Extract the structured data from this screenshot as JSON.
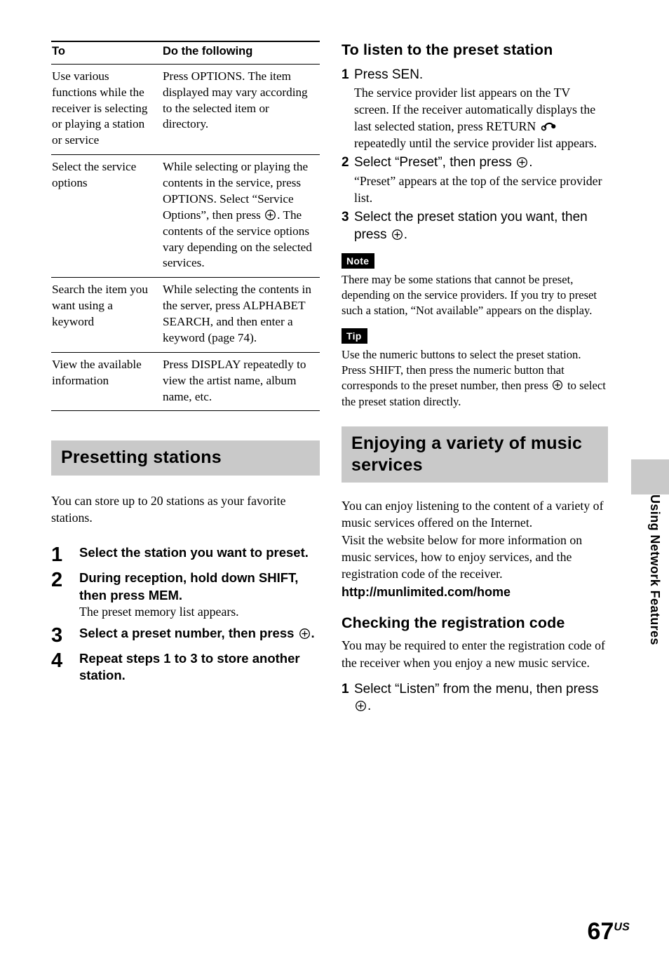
{
  "page": {
    "number": "67",
    "region_suffix": "US",
    "thumb_tab_label": "Using Network Features"
  },
  "left_column": {
    "table": {
      "headers": [
        "To",
        "Do the following"
      ],
      "rows": [
        {
          "to": "Use various functions while the receiver is selecting or playing a station or service",
          "do_parts": [
            "Press OPTIONS. The item displayed may vary according to the selected item or directory."
          ]
        },
        {
          "to": "Select the service options",
          "do_parts": [
            "While selecting or playing the contents in the service, press OPTIONS. Select “Service Options”, then press ",
            "ENTER_ICON",
            ". The contents of the service options vary depending on the selected services."
          ]
        },
        {
          "to": "Search the item you want using a keyword",
          "do_parts": [
            "While selecting the contents in the server, press ALPHABET SEARCH, and then enter a keyword (page 74)."
          ]
        },
        {
          "to": "View the available information",
          "do_parts": [
            "Press DISPLAY repeatedly to view the artist name, album name, etc."
          ]
        }
      ]
    },
    "section_heading": "Presetting stations",
    "intro": "You can store up to 20 stations as your favorite stations.",
    "steps": [
      {
        "num": "1",
        "instruction": "Select the station you want to preset.",
        "note": ""
      },
      {
        "num": "2",
        "instruction": "During reception, hold down SHIFT, then press MEM.",
        "note": "The preset memory list appears."
      },
      {
        "num": "3",
        "instruction_pre": "Select a preset number, then press ",
        "instruction_post": ".",
        "has_enter_icon": true,
        "note": ""
      },
      {
        "num": "4",
        "instruction": "Repeat steps 1 to 3 to store another station.",
        "note": ""
      }
    ]
  },
  "right_column": {
    "heading_listen": "To listen to the preset station",
    "steps_listen": [
      {
        "num": "1",
        "instruction": "Press SEN.",
        "note_pre": "The service provider list appears on the TV screen. If the receiver automatically displays the last selected station, press RETURN ",
        "note_post": " repeatedly until the service provider list appears.",
        "has_return_icon": true
      },
      {
        "num": "2",
        "instruction_pre": "Select “Preset”, then press ",
        "instruction_post": ".",
        "has_enter_icon": true,
        "note": "“Preset” appears at the top of the service provider list."
      },
      {
        "num": "3",
        "instruction_pre": "Select the preset station you want, then press ",
        "instruction_post": ".",
        "has_enter_icon": true,
        "note": ""
      }
    ],
    "note_badge": "Note",
    "note_text": "There may be some stations that cannot be preset, depending on the service providers. If you try to preset such a station, “Not available” appears on the display.",
    "tip_badge": "Tip",
    "tip_text_pre": "Use the numeric buttons to select the preset station. Press SHIFT, then press the numeric button that corresponds to the preset number, then press ",
    "tip_text_post": " to select the preset station directly.",
    "section_heading": "Enjoying a variety of music services",
    "enjoy_paragraph_1": "You can enjoy listening to the content of a variety of music services offered on the Internet.",
    "enjoy_paragraph_2": "Visit the website below for more information on music services, how to enjoy services, and the registration code of the receiver.",
    "url": "http://munlimited.com/home",
    "heading_registration": "Checking the registration code",
    "registration_paragraph": "You may be required to enter the registration code of the receiver when you enjoy a new music service.",
    "steps_registration": [
      {
        "num": "1",
        "instruction_pre": "Select “Listen” from the menu, then press ",
        "instruction_post": ".",
        "has_enter_icon": true
      }
    ]
  },
  "colors": {
    "heading_background": "#c9c9c9",
    "badge_background": "#000000",
    "text": "#000000",
    "page_background": "#ffffff"
  },
  "icons": {
    "enter": "circled-plus-enter-icon",
    "return": "return-curved-arrow-icon"
  }
}
